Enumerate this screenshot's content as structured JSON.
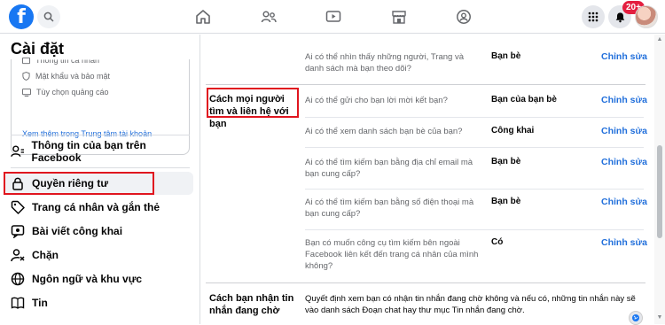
{
  "topbar": {
    "logo": "f",
    "notification_badge": "20+"
  },
  "sidebar": {
    "title": "Cài đặt",
    "card": {
      "item_personal_info": "Thông tin cá nhân",
      "item_password_security": "Mật khẩu và bảo mật",
      "item_ad_preferences": "Tùy chọn quảng cáo",
      "link": "Xem thêm trong Trung tâm tài khoản"
    },
    "items": [
      {
        "label": "Thông tin của bạn trên Facebook",
        "icon": "person-info-icon"
      },
      {
        "label": "Quyền riêng tư",
        "icon": "lock-icon"
      },
      {
        "label": "Trang cá nhân và gắn thẻ",
        "icon": "tag-icon"
      },
      {
        "label": "Bài viết công khai",
        "icon": "public-posts-icon"
      },
      {
        "label": "Chặn",
        "icon": "block-user-icon"
      },
      {
        "label": "Ngôn ngữ và khu vực",
        "icon": "globe-icon"
      },
      {
        "label": "Tin",
        "icon": "book-icon"
      }
    ]
  },
  "main": {
    "top_row": {
      "question": "Ai có thể nhìn thấy những người, Trang và danh sách mà bạn theo dõi?",
      "value": "Bạn bè",
      "edit": "Chỉnh sửa"
    },
    "section_label": "Cách mọi người tìm và liên hệ với bạn",
    "rows": [
      {
        "question": "Ai có thể gửi cho bạn lời mời kết bạn?",
        "value": "Bạn của bạn bè",
        "edit": "Chỉnh sửa"
      },
      {
        "question": "Ai có thể xem danh sách bạn bè của bạn?",
        "value": "Công khai",
        "edit": "Chỉnh sửa"
      },
      {
        "question": "Ai có thể tìm kiếm bạn bằng địa chỉ email mà bạn cung cấp?",
        "value": "Bạn bè",
        "edit": "Chỉnh sửa"
      },
      {
        "question": "Ai có thể tìm kiếm bạn bằng số điện thoại mà bạn cung cấp?",
        "value": "Bạn bè",
        "edit": "Chỉnh sửa"
      },
      {
        "question": "Bạn có muốn công cụ tìm kiếm bên ngoài Facebook liên kết đến trang cá nhân của mình không?",
        "value": "Có",
        "edit": "Chỉnh sửa"
      }
    ],
    "pending_label": "Cách bạn nhận tin nhắn đang chờ",
    "pending_desc": "Quyết định xem bạn có nhận tin nhắn đang chờ không và nếu có, những tin nhắn này sẽ vào danh sách Đoạn chat hay thư mục Tin nhắn đang chờ."
  }
}
